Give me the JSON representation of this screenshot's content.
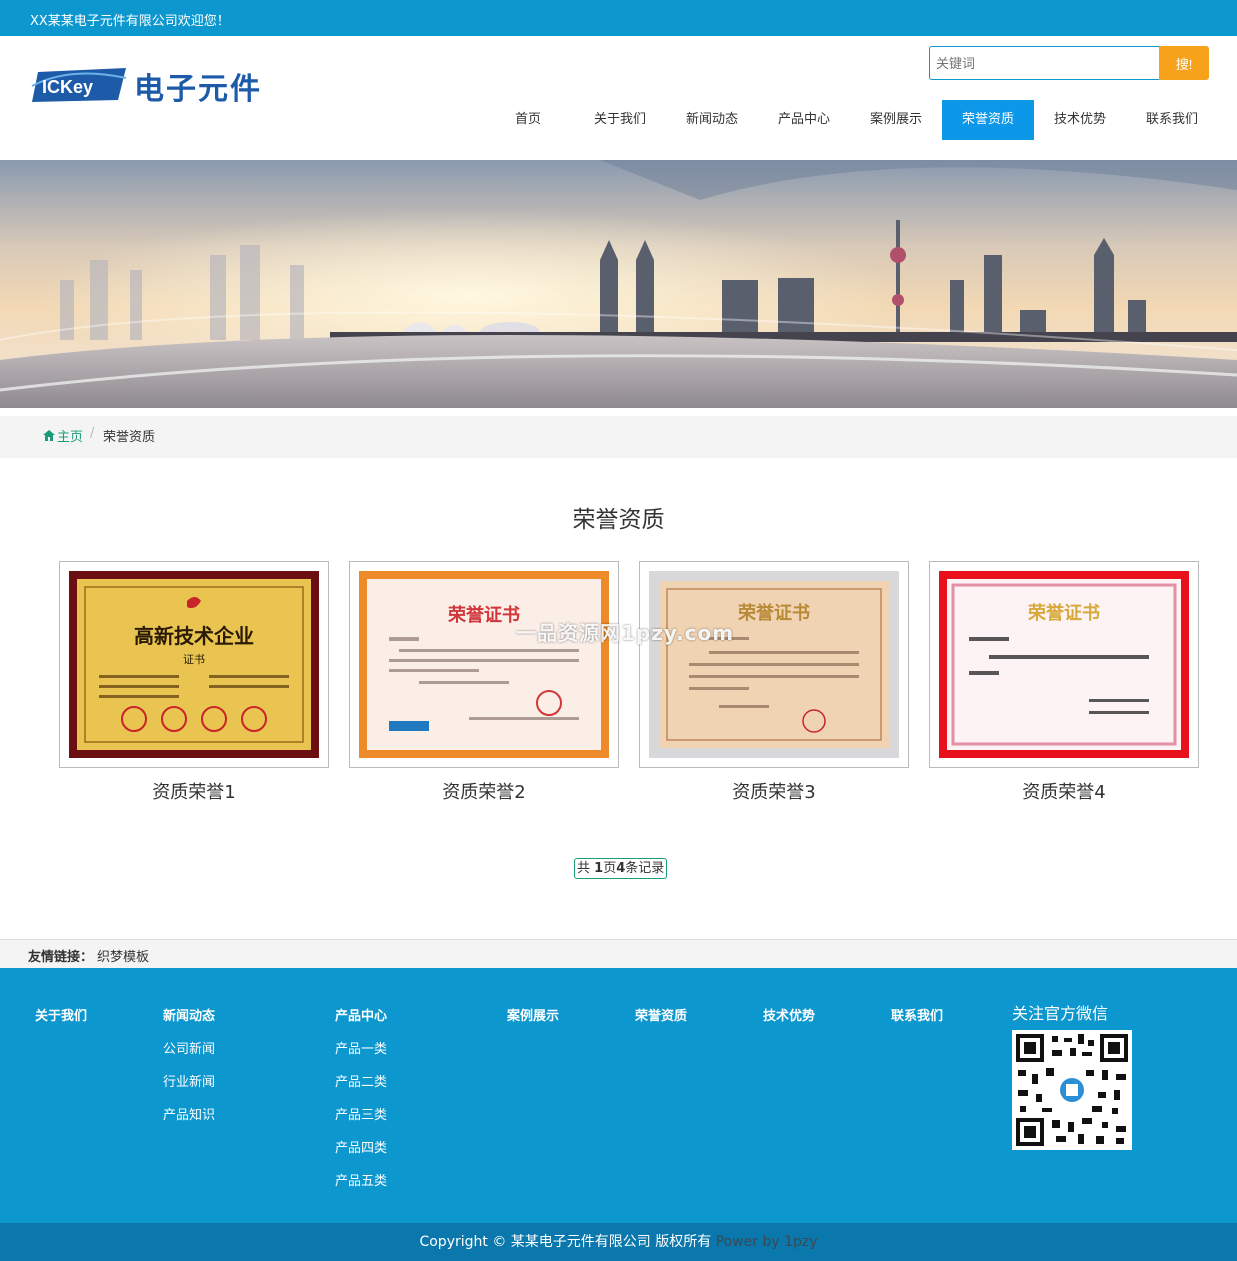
{
  "topbar": {
    "welcome": "XX某某电子元件有限公司欢迎您！"
  },
  "logo": {
    "badge_text": "ICKey",
    "name": "电子元件"
  },
  "search": {
    "placeholder": "关键词",
    "button_label": "搜!"
  },
  "nav": {
    "items": [
      {
        "label": "首页",
        "active": false
      },
      {
        "label": "关于我们",
        "active": false
      },
      {
        "label": "新闻动态",
        "active": false
      },
      {
        "label": "产品中心",
        "active": false
      },
      {
        "label": "案例展示",
        "active": false
      },
      {
        "label": "荣誉资质",
        "active": true
      },
      {
        "label": "技术优势",
        "active": false
      },
      {
        "label": "联系我们",
        "active": false
      }
    ]
  },
  "breadcrumb": {
    "home_icon": "home-icon",
    "home": "主页",
    "separator": "/",
    "current": "荣誉资质"
  },
  "section": {
    "title": "荣誉资质"
  },
  "certificates": [
    {
      "caption": "资质荣誉1",
      "heading": "高新技术企业",
      "sub": "证书"
    },
    {
      "caption": "资质荣誉2",
      "heading": "荣誉证书"
    },
    {
      "caption": "资质荣誉3",
      "heading": "荣誉证书"
    },
    {
      "caption": "资质荣誉4",
      "heading": "荣誉证书"
    }
  ],
  "watermark": "一品资源网1pzy.com",
  "pager": {
    "prefix": "共 ",
    "pages": "1",
    "mid": "页",
    "count": "4",
    "suffix": "条记录"
  },
  "links": {
    "label": "友情链接：",
    "items": [
      "织梦模板"
    ]
  },
  "footer": {
    "columns": [
      {
        "head": "关于我们",
        "subs": []
      },
      {
        "head": "新闻动态",
        "subs": [
          "公司新闻",
          "行业新闻",
          "产品知识"
        ]
      },
      {
        "head": "产品中心",
        "subs": [
          "产品一类",
          "产品二类",
          "产品三类",
          "产品四类",
          "产品五类"
        ]
      },
      {
        "head": "案例展示",
        "subs": []
      },
      {
        "head": "荣誉资质",
        "subs": []
      },
      {
        "head": "技术优势",
        "subs": []
      },
      {
        "head": "联系我们",
        "subs": []
      }
    ],
    "wechat_title": "关注官方微信"
  },
  "copyright": {
    "text": "Copyright © 某某电子元件有限公司 版权所有",
    "power": "Power by 1pzy"
  },
  "colors": {
    "primary": "#0d97cf",
    "nav_active": "#0d97e8",
    "search_button": "#f7a21b",
    "copyright_bg": "#0a77ad"
  }
}
